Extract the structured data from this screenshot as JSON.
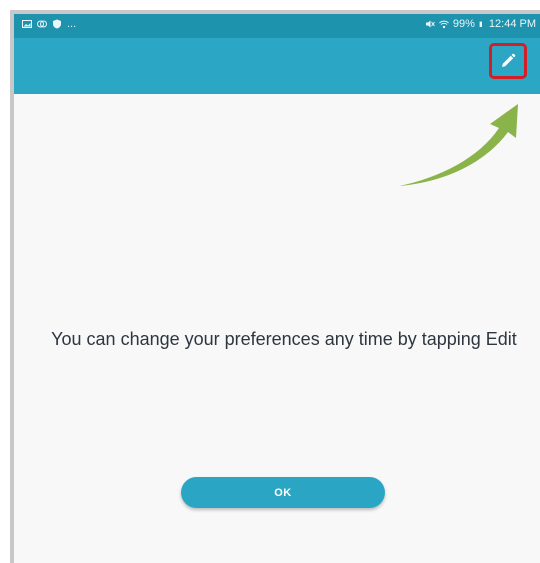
{
  "status_bar": {
    "left_extra": "...",
    "battery_percent": "99%",
    "time": "12:44 PM",
    "icons_left": [
      "image-icon",
      "cast-icon",
      "shield-icon"
    ],
    "icons_right": [
      "mute-icon",
      "wifi-icon",
      "battery-icon"
    ]
  },
  "app_bar": {
    "edit_icon": "pencil-icon",
    "edit_highlight_color": "#d21f26"
  },
  "annotation": {
    "arrow_color": "#8ab34a"
  },
  "message": {
    "text": "You can change your preferences any time by tapping Edit"
  },
  "ok_button": {
    "label": "OK"
  },
  "colors": {
    "status_bar": "#1e93ad",
    "app_bar": "#2ba7c5",
    "button": "#2aa6c4",
    "background": "#f8f8f8"
  }
}
